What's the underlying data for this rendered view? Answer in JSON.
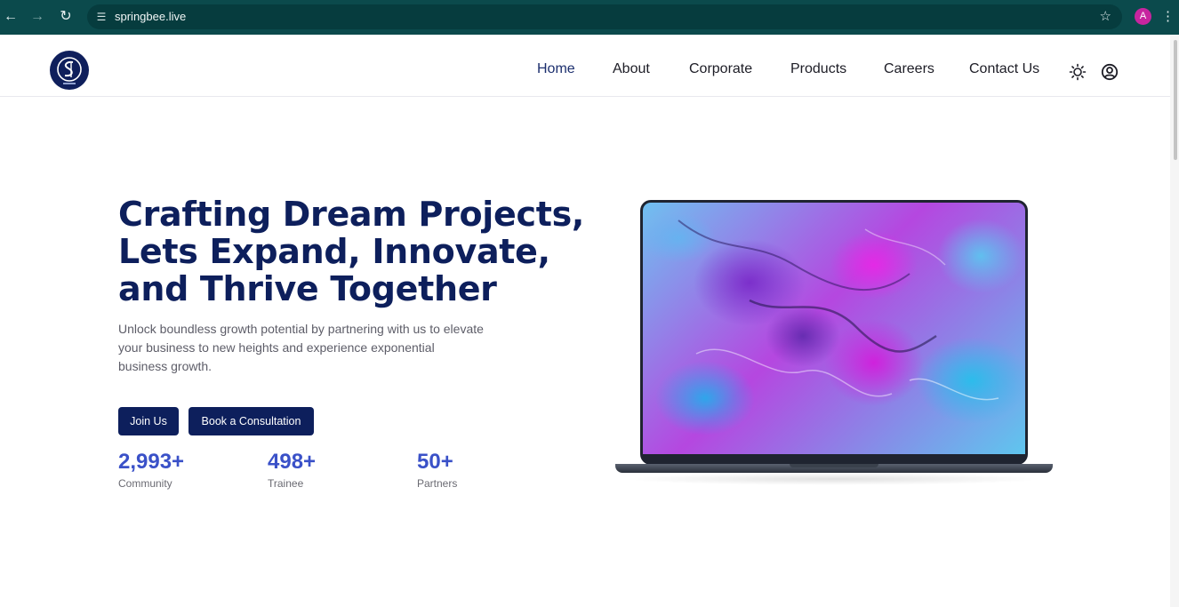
{
  "browser": {
    "url": "springbee.live",
    "profile_initial": "A",
    "icons": {
      "back": "arrow-left-icon",
      "forward": "arrow-right-icon",
      "reload": "reload-icon",
      "site_settings": "tune-icon",
      "bookmark": "star-icon",
      "menu": "kebab-menu-icon"
    },
    "colors": {
      "toolbar": "#0b4a4c",
      "profile": "#c7259f"
    }
  },
  "header": {
    "logo_alt": "SB logo",
    "nav": [
      {
        "label": "Home",
        "active": true
      },
      {
        "label": "About",
        "active": false
      },
      {
        "label": "Corporate",
        "active": false
      },
      {
        "label": "Products",
        "active": false
      },
      {
        "label": "Careers",
        "active": false
      },
      {
        "label": "Contact Us",
        "active": false
      }
    ],
    "icons": {
      "theme": "sun-icon",
      "account": "user-circle-icon"
    }
  },
  "hero": {
    "title_lines": [
      "Crafting Dream Projects,",
      "Lets Expand, Innovate,",
      "and Thrive Together"
    ],
    "subtitle_lines": [
      "Unlock boundless growth potential by partnering with us to elevate",
      "your business to new heights and experience exponential",
      "business growth."
    ],
    "buttons": {
      "join": "Join Us",
      "consult": "Book a Consultation"
    },
    "stats": [
      {
        "value": "2,993+",
        "label": "Community"
      },
      {
        "value": "498+",
        "label": "Trainee"
      },
      {
        "value": "50+",
        "label": "Partners"
      }
    ],
    "colors": {
      "primary": "#0d1f5c",
      "stat": "#3a51c8"
    }
  }
}
